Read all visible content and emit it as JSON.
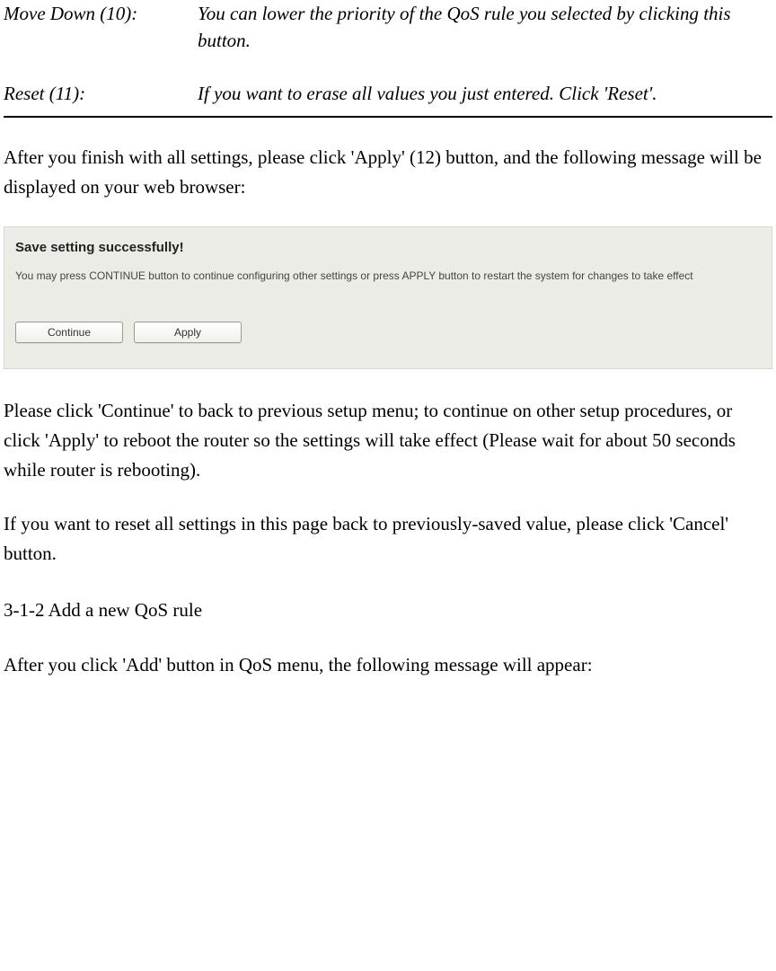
{
  "definitions": {
    "moveDown": {
      "label": "Move Down (10):",
      "desc": "You can lower the priority of the QoS rule you selected by clicking this button."
    },
    "reset": {
      "label": "Reset (11):",
      "desc": "If you want to erase all values you just entered. Click 'Reset'."
    }
  },
  "para1": "After you finish with all settings, please click 'Apply' (12) button, and the following message will be displayed on your web browser:",
  "dialog": {
    "title": "Save setting successfully!",
    "message": "You may press CONTINUE button to continue configuring other settings or press APPLY button to restart the system for changes to take effect",
    "continueLabel": "Continue",
    "applyLabel": "Apply"
  },
  "para2": "Please click 'Continue' to back to previous setup menu; to continue on other setup procedures, or click 'Apply' to reboot the router so the settings will take effect (Please wait for about 50 seconds while router is rebooting).",
  "para3": "If you want to reset all settings in this page back to previously-saved value, please click 'Cancel' button.",
  "sectionHeading": "3-1-2 Add a new QoS rule",
  "para4": "After you click 'Add' button in QoS menu, the following message will appear:"
}
